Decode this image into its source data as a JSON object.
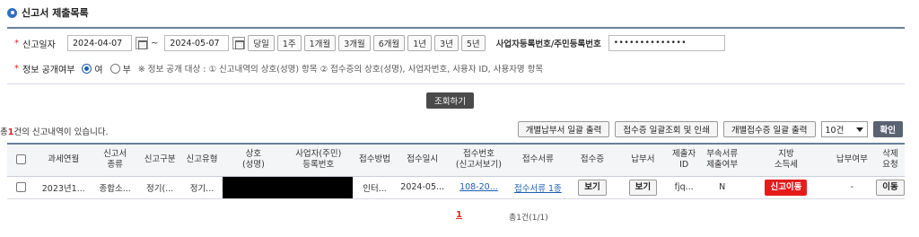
{
  "page": {
    "title": "신고서 제출목록"
  },
  "search": {
    "date_label": "신고일자",
    "date_from": "2024-04-07",
    "date_to": "2024-05-07",
    "tilde": "~",
    "period_buttons": [
      "당일",
      "1주",
      "1개월",
      "3개월",
      "6개월",
      "1년",
      "3년",
      "5년"
    ],
    "id_label": "사업자등록번호/주민등록번호",
    "id_value": "••••••••••••••",
    "disclose_label": "정보 공개여부",
    "yes_label": "여",
    "no_label": "부",
    "disclose_note": "※ 정보 공개 대상 : ① 신고내역의 상호(성명) 항목 ② 접수증의 상호(성명), 사업자번호, 사용자 ID, 사용자명 항목",
    "query_button": "조회하기"
  },
  "results": {
    "count_prefix": "총",
    "count": "1",
    "count_suffix": "건의 신고내역이 있습니다.",
    "actions": [
      "개별납부서 일괄 출력",
      "접수증 일괄조회 및 인쇄",
      "개별접수증 일괄 출력"
    ],
    "page_size": "10건",
    "confirm_button": "확인"
  },
  "table": {
    "headers": [
      "과세연월",
      "신고서\n종류",
      "신고구분",
      "신고유형",
      "상호\n(성명)",
      "사업자(주민)\n등록번호",
      "접수방법",
      "접수일시",
      "접수번호\n(신고서보기)",
      "접수서류",
      "접수증",
      "납부서",
      "제출자\nID",
      "부속서류\n제출여부",
      "지방\n소득세",
      "납부여부",
      "삭제\n요청"
    ],
    "rows": [
      {
        "period": "2023년1...",
        "form_type": "종합소...",
        "report_class": "정기(...",
        "report_type": "정기...",
        "name": "",
        "reg_no": "",
        "method": "인터...",
        "received_at": "2024-05...",
        "receipt_no": "108-20...",
        "documents": "접수서류 1종",
        "receipt_btn": "보기",
        "payment_btn": "보기",
        "submitter_id": "fjq...",
        "attachments": "N",
        "local_tax_btn": "신고이동",
        "paid": "-",
        "delete_btn": "이동"
      }
    ]
  },
  "pagination": {
    "current": "1",
    "summary": "총1건(1/1)"
  },
  "colors": {
    "accent": "#2f6fc0",
    "danger": "#e51c1c",
    "header_border": "#6a7f9c"
  },
  "icons": [
    "info-circle-icon",
    "calendar-icon",
    "dropdown-arrow-icon"
  ]
}
